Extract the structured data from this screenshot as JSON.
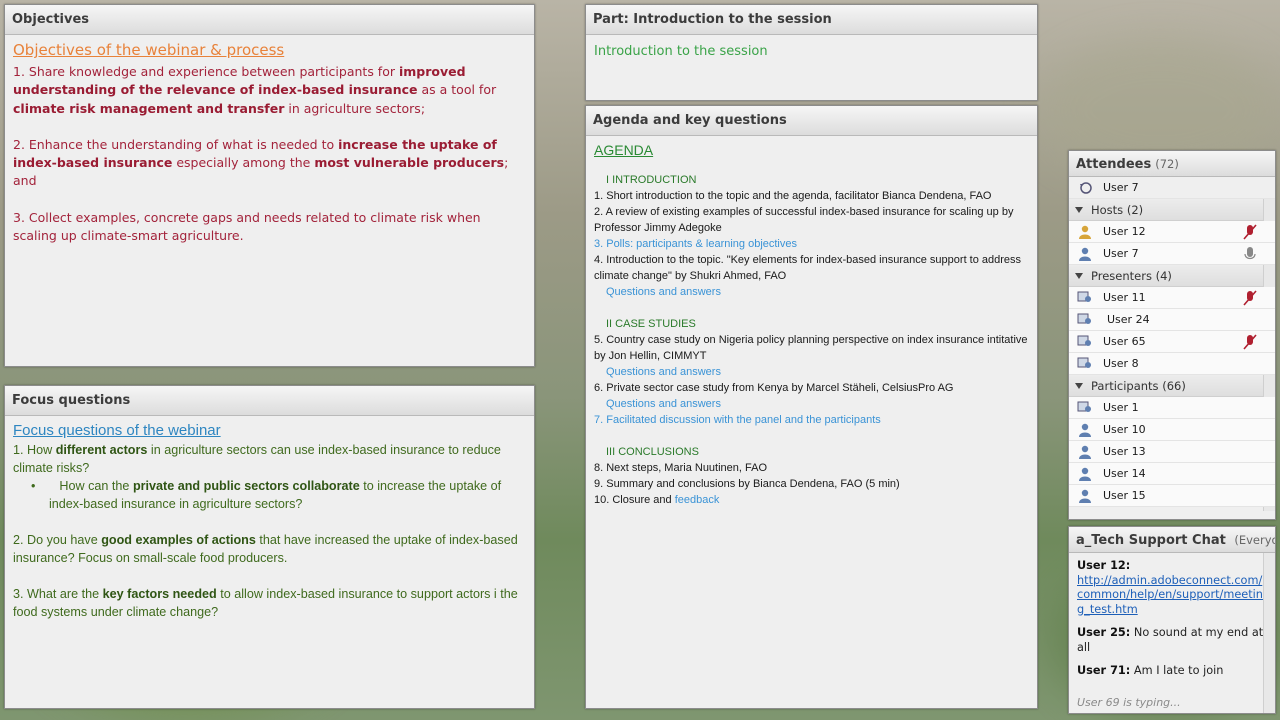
{
  "objectives_pod": {
    "header": "Objectives",
    "title": "Objectives of the webinar & process",
    "p1_a": "1. Share knowledge and experience between participants for ",
    "p1_b": "improved understanding of the relevance of index-based insurance",
    "p1_c": " as a tool for ",
    "p1_d": "climate risk management and transfer",
    "p1_e": " in agriculture sectors;",
    "p2_a": "2. Enhance the understanding of what is needed to ",
    "p2_b": "increase the uptake of index-based insurance",
    "p2_c": " especially among the ",
    "p2_d": " most vulnerable producers",
    "p2_e": "; and",
    "p3": "3. Collect examples, concrete gaps and needs related to climate risk when scaling up climate-smart agriculture."
  },
  "focus_pod": {
    "header": "Focus questions",
    "title": "Focus questions of the webinar",
    "q1_a": "1.    How ",
    "q1_b": "different actors",
    "q1_c": " in agriculture sectors can use index-based insurance to reduce climate risks?",
    "q1s_bullet": "•",
    "q1s_a": "How can the ",
    "q1s_b": "private and public sectors collaborate",
    "q1s_c": " to increase the uptake of index-based insurance in agriculture sectors?",
    "q2_a": "2.    Do you have ",
    "q2_b": "good examples of actions",
    "q2_c": " that have increased the uptake of index-based insurance? Focus on small-scale food producers.",
    "q3_a": "3.    What are the ",
    "q3_b": "key factors needed",
    "q3_c": " to allow index-based insurance to support actors i the food systems under climate change?"
  },
  "part_pod": {
    "header": "Part: Introduction to the session",
    "title": "Introduction to the session"
  },
  "agenda_pod": {
    "header": "Agenda and key questions",
    "title": "AGENDA",
    "s1": "I  INTRODUCTION",
    "l1": "1. Short introduction to the topic and the agenda,  facilitator Bianca Dendena, FAO",
    "l2": "2. A review of existing examples of successful index-based insurance for scaling up by Professor Jimmy Adegoke",
    "l3": "3. Polls: participants & learning objectives",
    "l4": "4. Introduction to the topic. \"Key elements for index-based insurance support to address climate change\" by Shukri Ahmed, FAO",
    "qa1": "Questions and answers",
    "s2": "II CASE STUDIES",
    "l5": "5. Country case study on Nigeria policy planning perspective on index insurance intitative by Jon Hellin, CIMMYT",
    "qa2": "Questions and answers",
    "l6": "6. Private sector case study from Kenya by Marcel Stäheli, CelsiusPro AG",
    "qa3": "Questions and answers",
    "l7": "7.    Facilitated discussion with the panel and the participants",
    "s3": "III   CONCLUSIONS",
    "l8": "8.    Next steps, Maria Nuutinen, FAO",
    "l9": "9.    Summary and conclusions by Bianca Dendena, FAO (5 min)",
    "l10_a": "10. Closure and ",
    "l10_b": "feedback"
  },
  "attendees_pod": {
    "header": "Attendees",
    "count": "(72)",
    "me": "User 7",
    "hosts_label": "Hosts (2)",
    "hosts": [
      "User 12",
      "User 7"
    ],
    "presenters_label": "Presenters (4)",
    "presenters": [
      "User 11",
      "User 24",
      "User 65",
      "User 8"
    ],
    "participants_label": "Participants (66)",
    "participants": [
      "User 1",
      "User 10",
      "User 13",
      "User 14",
      "User 15"
    ]
  },
  "chat_pod": {
    "header": "a_Tech Support Chat",
    "scope": "(Everyo...",
    "m1_user": "User 12:",
    "m1_link": "http://admin.adobeconnect.com/common/help/en/support/meeting_test.htm",
    "m2_user": "User 25:",
    "m2_text": " No sound at my end at all",
    "m3_user": "User 71:",
    "m3_text": " Am I late to join",
    "typing": "User 69 is typing..."
  },
  "colors": {
    "objectives_text": "#a3233b",
    "focus_text": "#3f6a1d",
    "agenda_link": "#3a93d6"
  }
}
